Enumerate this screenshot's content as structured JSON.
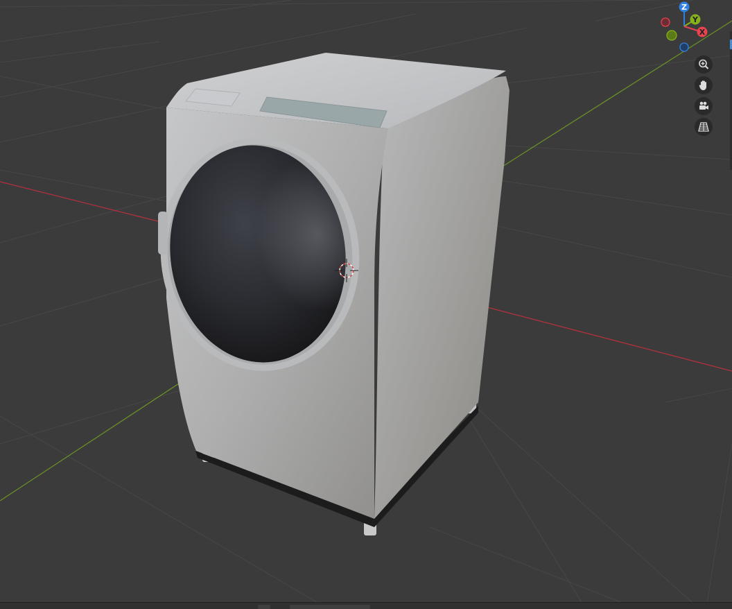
{
  "viewport": {
    "gizmo": {
      "z_label": "Z",
      "y_label": "Y",
      "x_label": "X",
      "colors": {
        "x": "#e8434f",
        "y": "#86b01c",
        "z": "#2f80e0"
      }
    },
    "nav_buttons": [
      {
        "icon": "zoom-icon"
      },
      {
        "icon": "hand-pan-icon"
      },
      {
        "icon": "camera-icon"
      },
      {
        "icon": "ortho-grid-icon"
      }
    ],
    "object": "washing-machine",
    "axis_colors": {
      "x_axis": "#b2323c",
      "y_axis": "#6a8f26"
    },
    "background": "#3b3b3b"
  }
}
